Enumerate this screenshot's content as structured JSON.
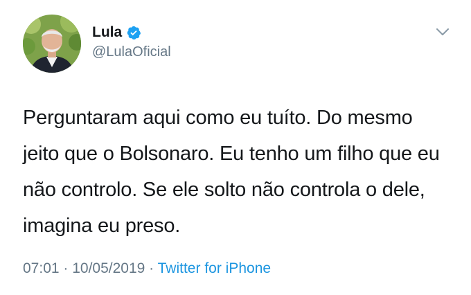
{
  "author": {
    "display_name": "Lula",
    "handle": "@LulaOficial",
    "verified": true,
    "avatar_icon": "profile-photo"
  },
  "tweet": {
    "text": "Perguntaram aqui como eu tuíto. Do mesmo jeito que o Bolsonaro. Eu tenho um filho que eu não controlo. Se ele solto não controla o dele, imagina eu preso."
  },
  "meta": {
    "time": "07:01",
    "separator1": " · ",
    "date": "10/05/2019",
    "separator2": " · ",
    "source": "Twitter for iPhone"
  },
  "colors": {
    "text": "#14171a",
    "secondary": "#657786",
    "accent": "#1b95e0",
    "verified_badge": "#1da1f2"
  }
}
